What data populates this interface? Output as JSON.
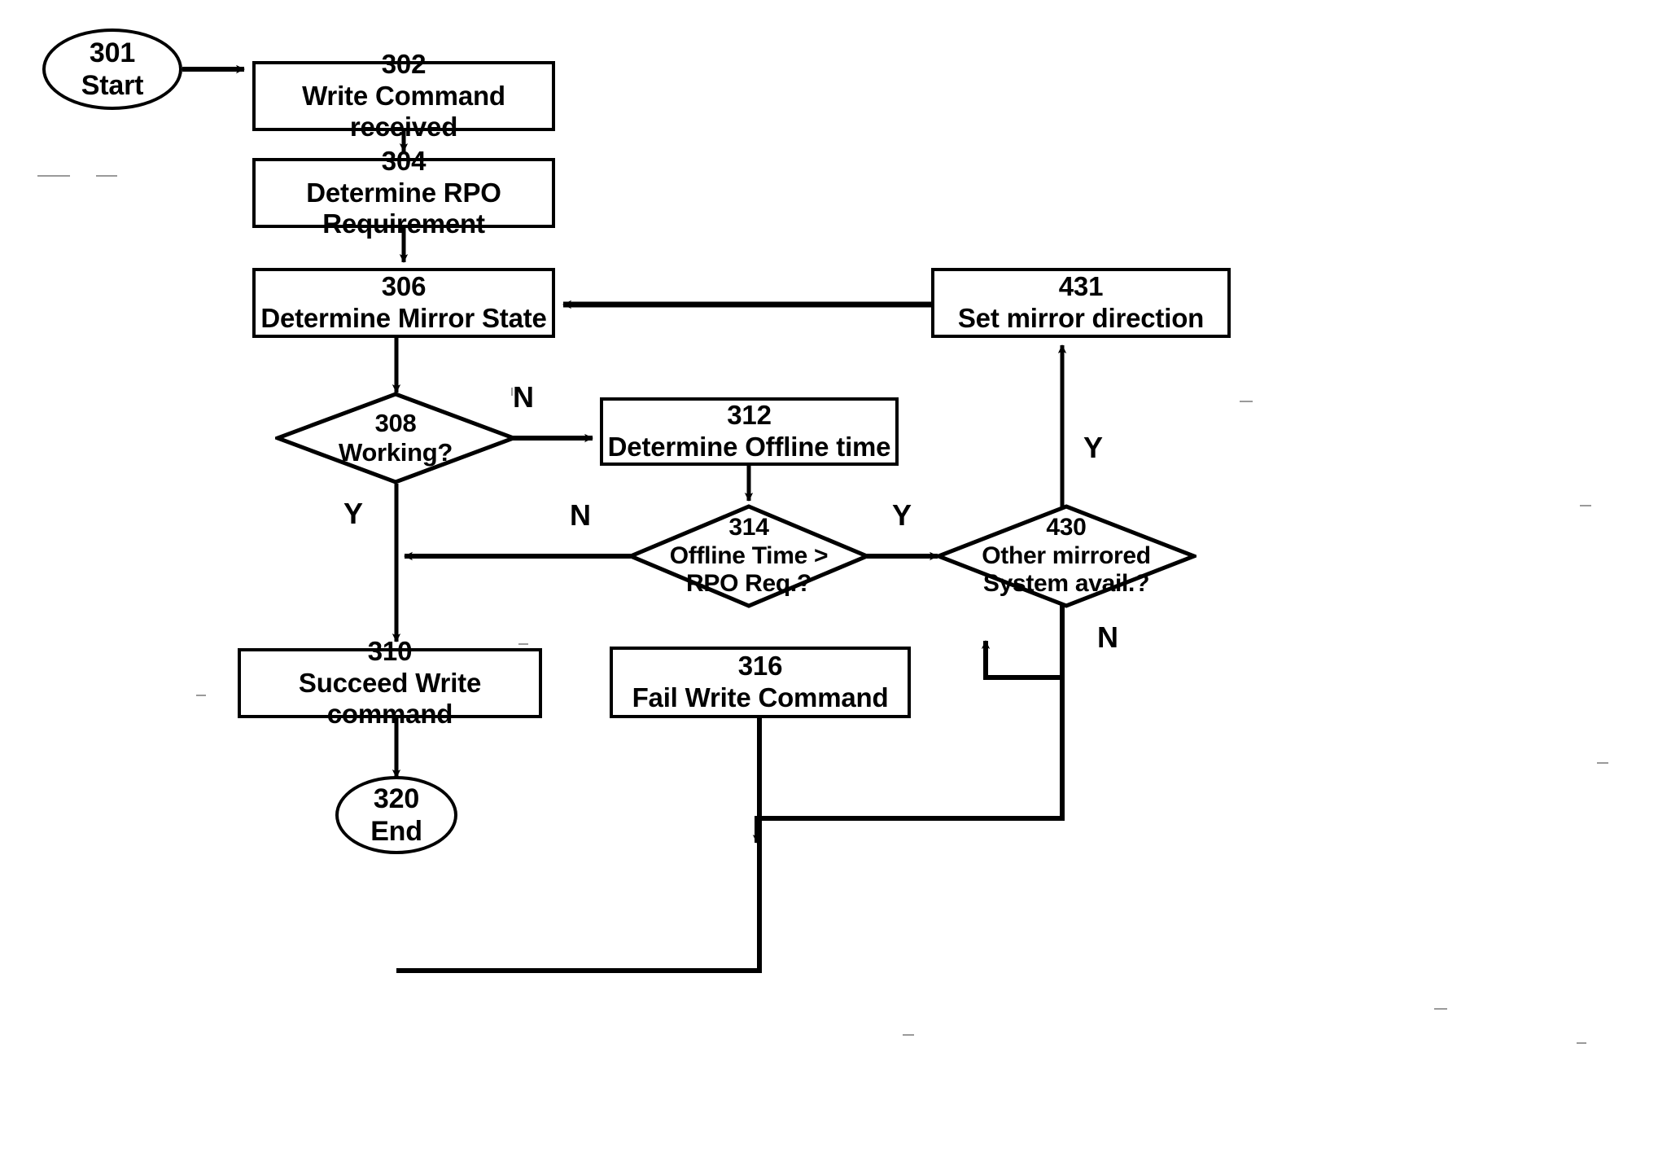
{
  "diagram": {
    "type": "flowchart",
    "title": "",
    "nodes": [
      {
        "id": "301",
        "shape": "terminator",
        "ref": "301",
        "text": "Start"
      },
      {
        "id": "302",
        "shape": "process",
        "ref": "302",
        "text": "Write Command received"
      },
      {
        "id": "304",
        "shape": "process",
        "ref": "304",
        "text": "Determine RPO Requirement"
      },
      {
        "id": "306",
        "shape": "process",
        "ref": "306",
        "text": "Determine Mirror State"
      },
      {
        "id": "431",
        "shape": "process",
        "ref": "431",
        "text": "Set mirror direction"
      },
      {
        "id": "308",
        "shape": "decision",
        "ref": "308",
        "text": "Working?"
      },
      {
        "id": "312",
        "shape": "process",
        "ref": "312",
        "text": "Determine Offline time"
      },
      {
        "id": "314",
        "shape": "decision",
        "ref": "314",
        "text": "Offline Time >",
        "text2": "RPO Req.?"
      },
      {
        "id": "430",
        "shape": "decision",
        "ref": "430",
        "text": "Other mirrored",
        "text2": "System avail.?"
      },
      {
        "id": "310",
        "shape": "process",
        "ref": "310",
        "text": "Succeed Write command"
      },
      {
        "id": "316",
        "shape": "process",
        "ref": "316",
        "text": "Fail Write Command"
      },
      {
        "id": "320",
        "shape": "terminator",
        "ref": "320",
        "text": "End"
      }
    ],
    "edge_labels": [
      {
        "id": "n-308",
        "label": "N",
        "from": "308",
        "to": "312"
      },
      {
        "id": "y-308",
        "label": "Y",
        "from": "308",
        "to": "310"
      },
      {
        "id": "n-314",
        "label": "N",
        "from": "314",
        "to": "310"
      },
      {
        "id": "y-314",
        "label": "Y",
        "from": "314",
        "to": "430"
      },
      {
        "id": "y-430",
        "label": "Y",
        "from": "430",
        "to": "431"
      },
      {
        "id": "n-430",
        "label": "N",
        "from": "430",
        "to": "316"
      }
    ],
    "edges": [
      {
        "from": "301",
        "to": "302",
        "label": ""
      },
      {
        "from": "302",
        "to": "304",
        "label": ""
      },
      {
        "from": "304",
        "to": "306",
        "label": ""
      },
      {
        "from": "306",
        "to": "308",
        "label": ""
      },
      {
        "from": "308",
        "to": "312",
        "label": "N"
      },
      {
        "from": "308",
        "to": "310",
        "label": "Y"
      },
      {
        "from": "312",
        "to": "314",
        "label": ""
      },
      {
        "from": "314",
        "to": "310",
        "label": "N"
      },
      {
        "from": "314",
        "to": "430",
        "label": "Y"
      },
      {
        "from": "430",
        "to": "431",
        "label": "Y"
      },
      {
        "from": "430",
        "to": "316",
        "label": "N"
      },
      {
        "from": "431",
        "to": "306",
        "label": ""
      },
      {
        "from": "310",
        "to": "320",
        "label": ""
      },
      {
        "from": "316",
        "to": "320",
        "label": ""
      }
    ],
    "colors": {
      "stroke": "#000000",
      "fill": "#ffffff",
      "text": "#000000"
    }
  }
}
